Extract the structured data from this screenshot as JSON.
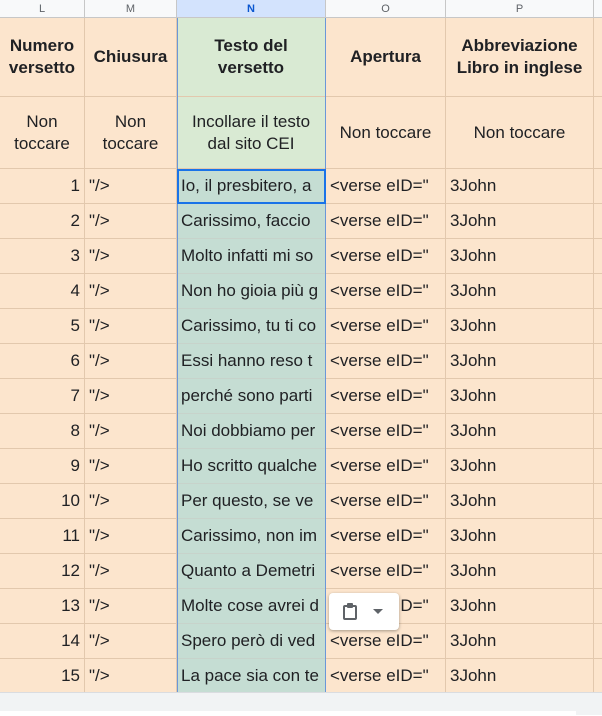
{
  "columns": [
    "L",
    "M",
    "N",
    "O",
    "P"
  ],
  "headers": {
    "l": "Numero versetto",
    "m": "Chiusura",
    "n": "Testo del versetto",
    "o": "Apertura",
    "p": "Abbreviazione Libro in inglese"
  },
  "subheaders": {
    "l": "Non toccare",
    "m": "Non toccare",
    "n": "Incollare il testo dal sito CEI",
    "o": "Non toccare",
    "p": "Non toccare"
  },
  "rows": [
    {
      "num": "1",
      "close": "\"/>",
      "text": "Io, il presbitero, a",
      "open": "<verse eID=\"",
      "abbr": "3John"
    },
    {
      "num": "2",
      "close": "\"/>",
      "text": "Carissimo, faccio",
      "open": "<verse eID=\"",
      "abbr": "3John"
    },
    {
      "num": "3",
      "close": "\"/>",
      "text": "Molto infatti mi so",
      "open": "<verse eID=\"",
      "abbr": "3John"
    },
    {
      "num": "4",
      "close": "\"/>",
      "text": "Non ho gioia più g",
      "open": "<verse eID=\"",
      "abbr": "3John"
    },
    {
      "num": "5",
      "close": "\"/>",
      "text": "Carissimo, tu ti co",
      "open": "<verse eID=\"",
      "abbr": "3John"
    },
    {
      "num": "6",
      "close": "\"/>",
      "text": "Essi hanno reso t",
      "open": "<verse eID=\"",
      "abbr": "3John"
    },
    {
      "num": "7",
      "close": "\"/>",
      "text": "perché sono parti",
      "open": "<verse eID=\"",
      "abbr": "3John"
    },
    {
      "num": "8",
      "close": "\"/>",
      "text": "Noi dobbiamo per",
      "open": "<verse eID=\"",
      "abbr": "3John"
    },
    {
      "num": "9",
      "close": "\"/>",
      "text": "Ho scritto qualche",
      "open": "<verse eID=\"",
      "abbr": "3John"
    },
    {
      "num": "10",
      "close": "\"/>",
      "text": "Per questo, se ve",
      "open": "<verse eID=\"",
      "abbr": "3John"
    },
    {
      "num": "11",
      "close": "\"/>",
      "text": "Carissimo, non im",
      "open": "<verse eID=\"",
      "abbr": "3John"
    },
    {
      "num": "12",
      "close": "\"/>",
      "text": "Quanto a Demetri",
      "open": "<verse eID=\"",
      "abbr": "3John"
    },
    {
      "num": "13",
      "close": "\"/>",
      "text": "Molte cose avrei d",
      "open": "<verse eID=\"",
      "abbr": "3John"
    },
    {
      "num": "14",
      "close": "\"/>",
      "text": "Spero però di ved",
      "open": "<verse eID=\"",
      "abbr": "3John"
    },
    {
      "num": "15",
      "close": "\"/>",
      "text": "La pace sia con te",
      "open": "<verse eID=\"",
      "abbr": "3John"
    }
  ],
  "paste_menu": {
    "icon": "clipboard-icon",
    "dropdown_icon": "chevron-down-icon"
  },
  "colors": {
    "header_fill": "#fce5cd",
    "text_column_fill": "#c5ddd3",
    "selection": "#1a73e8"
  }
}
